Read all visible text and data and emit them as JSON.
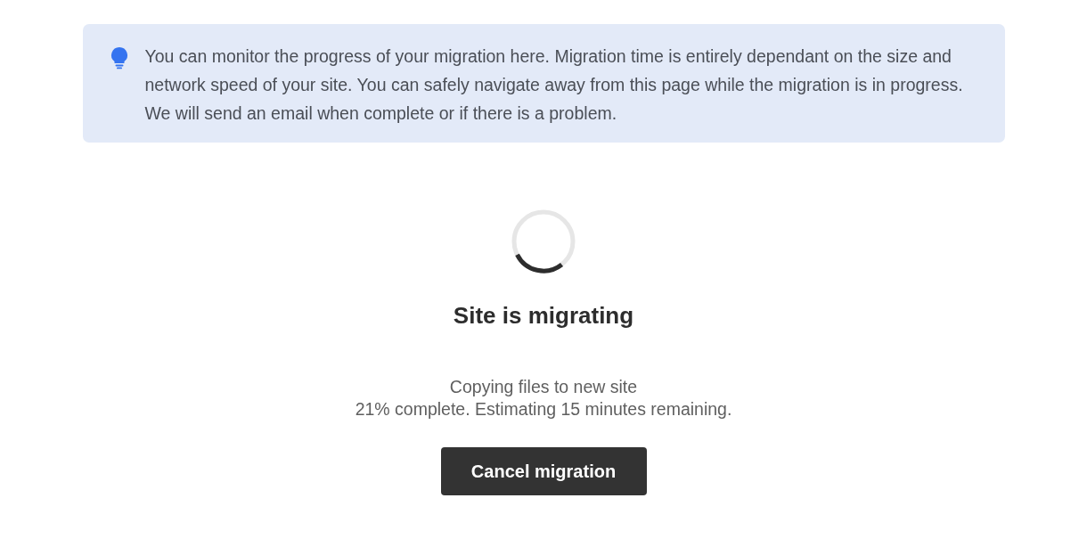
{
  "notice": {
    "text": "You can monitor the progress of your migration here. Migration time is entirely dependant on the size and network speed of your site. You can safely navigate away from this page while the migration is in progress. We will send an email when complete or if there is a problem."
  },
  "status": {
    "title": "Site is migrating",
    "step": "Copying files to new site",
    "detail": "21% complete. Estimating 15 minutes remaining."
  },
  "buttons": [
    {
      "label": "Cancel migration"
    }
  ]
}
